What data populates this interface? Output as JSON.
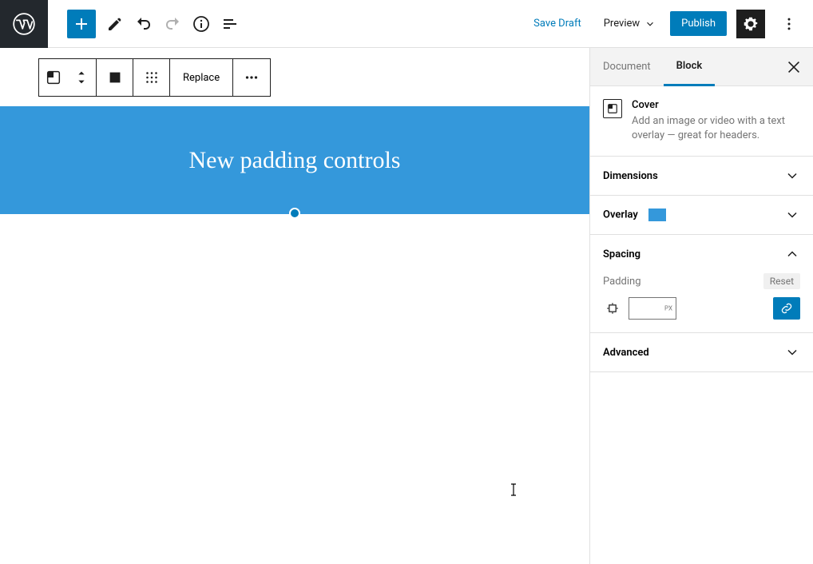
{
  "topbar": {
    "save_draft": "Save Draft",
    "preview": "Preview",
    "publish": "Publish"
  },
  "block_toolbar": {
    "replace": "Replace"
  },
  "cover": {
    "text": "New padding controls"
  },
  "sidebar": {
    "tabs": {
      "document": "Document",
      "block": "Block"
    },
    "block_header": {
      "title": "Cover",
      "desc": "Add an image or video with a text overlay — great for headers."
    },
    "panels": {
      "dimensions": "Dimensions",
      "overlay": "Overlay",
      "spacing": "Spacing",
      "advanced": "Advanced"
    },
    "spacing": {
      "padding_label": "Padding",
      "reset": "Reset",
      "unit": "PX"
    },
    "overlay_color": "#3498db"
  },
  "colors": {
    "accent": "#007cba",
    "cover_bg": "#3498db"
  }
}
